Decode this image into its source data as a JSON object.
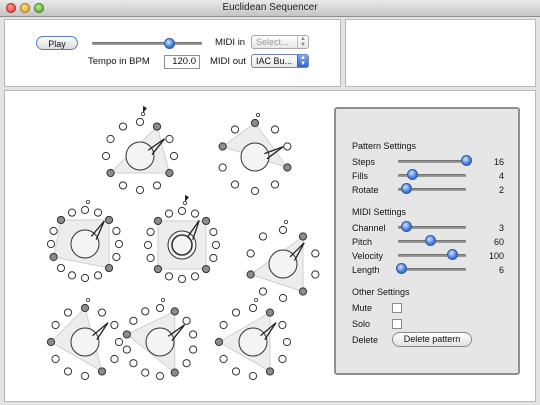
{
  "window": {
    "title": "Euclidean Sequencer"
  },
  "transport": {
    "play_label": "Play",
    "tempo_label": "Tempo in BPM",
    "tempo_value": "120.0",
    "tempo_slider_level": 0.7
  },
  "midi": {
    "in_label": "MIDI in",
    "in_selected": "Select...",
    "out_label": "MIDI out",
    "out_selected": "IAC Bu..."
  },
  "settings": {
    "pattern_heading": "Pattern Settings",
    "steps_label": "Steps",
    "steps_value": "16",
    "steps_level": 1.0,
    "fills_label": "Fills",
    "fills_value": "4",
    "fills_level": 0.2,
    "rotate_label": "Rotate",
    "rotate_value": "2",
    "rotate_level": 0.12,
    "midi_heading": "MIDI Settings",
    "channel_label": "Channel",
    "channel_value": "3",
    "channel_level": 0.12,
    "pitch_label": "Pitch",
    "pitch_value": "60",
    "pitch_level": 0.47,
    "velocity_label": "Velocity",
    "velocity_value": "100",
    "velocity_level": 0.79,
    "length_label": "Length",
    "length_value": "6",
    "length_level": 0.04,
    "other_heading": "Other Settings",
    "mute_label": "Mute",
    "mute_checked": false,
    "solo_label": "Solo",
    "solo_checked": false,
    "delete_label": "Delete",
    "delete_button": "Delete pattern"
  }
}
